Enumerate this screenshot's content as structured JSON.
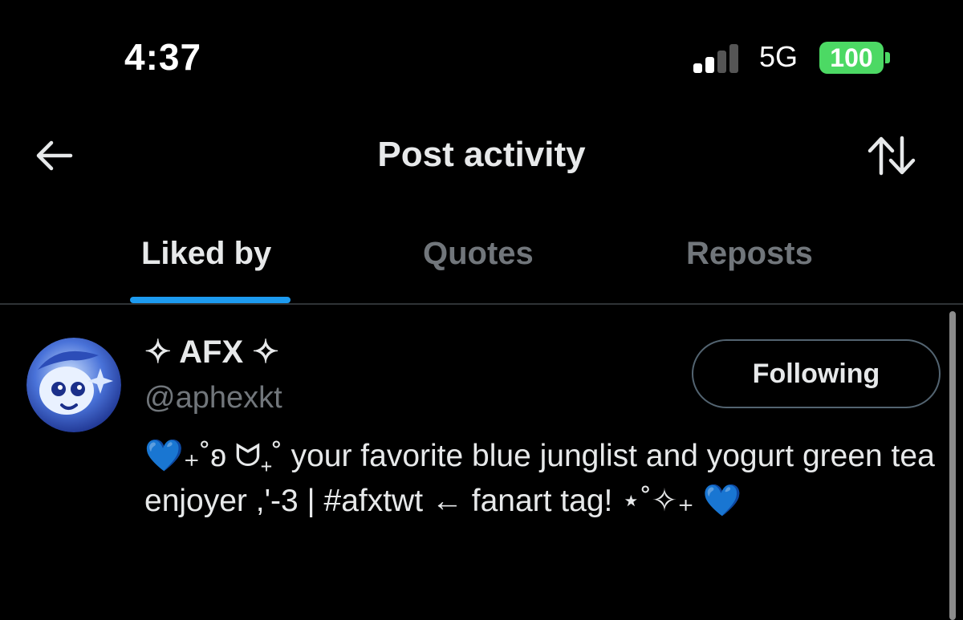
{
  "status_bar": {
    "time": "4:37",
    "network": "5G",
    "battery": "100",
    "battery_color": "#4cd964"
  },
  "header": {
    "title": "Post activity",
    "back_icon": "arrow-left-icon",
    "sort_icon": "sort-arrows-icon"
  },
  "tabs": [
    {
      "label": "Liked by",
      "active": true
    },
    {
      "label": "Quotes",
      "active": false
    },
    {
      "label": "Reposts",
      "active": false
    }
  ],
  "accent_color": "#1d9bf0",
  "user": {
    "display_name": "✧ AFX ✧",
    "handle": "@aphexkt",
    "follow_label": "Following",
    "bio": "💙₊˚ʚ ᗢ₊˚ your favorite blue junglist and yogurt green tea enjoyer ,'-3 | #afxtwt ← fanart tag! ⋆˚✧₊ 💙"
  }
}
